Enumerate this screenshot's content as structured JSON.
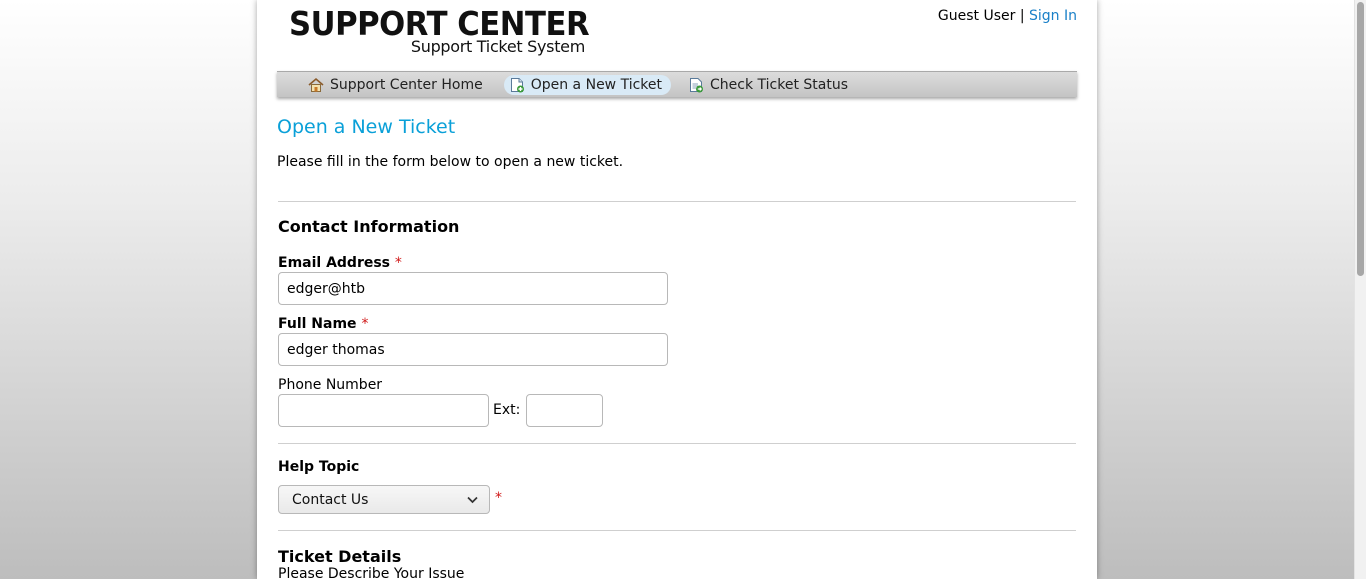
{
  "header": {
    "logo_title": "SUPPORT CENTER",
    "logo_subtitle": "Support Ticket System",
    "user_label": "Guest User",
    "separator": "|",
    "sign_in": "Sign In"
  },
  "nav": {
    "items": [
      {
        "label": "Support Center Home",
        "icon": "home-icon",
        "active": false
      },
      {
        "label": "Open a New Ticket",
        "icon": "new-ticket-icon",
        "active": true
      },
      {
        "label": "Check Ticket Status",
        "icon": "ticket-status-icon",
        "active": false
      }
    ]
  },
  "main": {
    "title": "Open a New Ticket",
    "intro": "Please fill in the form below to open a new ticket."
  },
  "contact": {
    "section_title": "Contact Information",
    "email_label": "Email Address",
    "email_value": "edger@htb",
    "name_label": "Full Name",
    "name_value": "edger thomas",
    "phone_label": "Phone Number",
    "phone_value": "",
    "ext_label": "Ext:",
    "ext_value": "",
    "required_mark": "*"
  },
  "help_topic": {
    "label": "Help Topic",
    "selected": "Contact Us",
    "required_mark": "*"
  },
  "ticket": {
    "section_title": "Ticket Details",
    "describe_label": "Please Describe Your Issue"
  },
  "colors": {
    "title_blue": "#0aa0d8",
    "link_blue": "#1a80c8",
    "required_red": "#d01818",
    "active_tab": "#d9eaf6"
  }
}
